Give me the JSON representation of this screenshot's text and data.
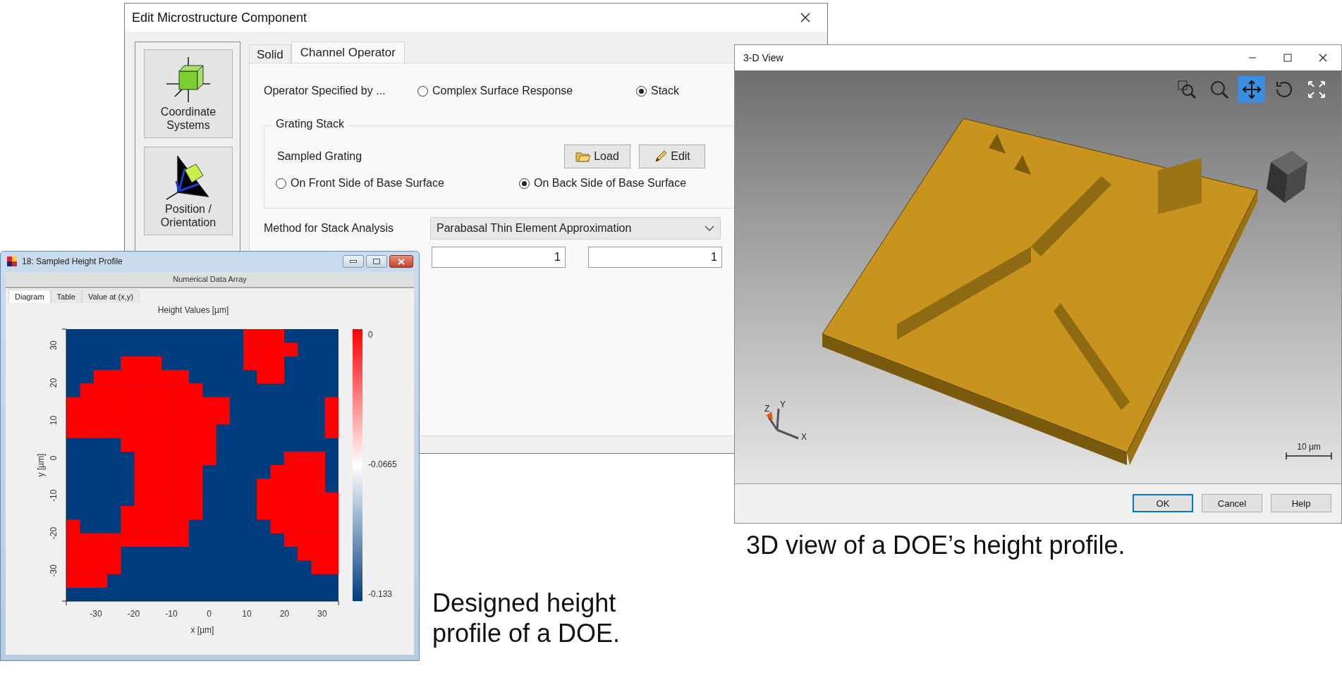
{
  "edit_dialog": {
    "title": "Edit Microstructure Component",
    "sidebar": [
      {
        "label": "Coordinate Systems",
        "kind": "axes"
      },
      {
        "label": "Position / Orientation",
        "kind": "position"
      }
    ],
    "tabs": [
      {
        "label": "Solid",
        "selected": false
      },
      {
        "label": "Channel Operator",
        "selected": true
      }
    ],
    "operator": {
      "label": "Operator Specified by ...",
      "options": [
        {
          "label": "Complex Surface Response",
          "selected": false
        },
        {
          "label": "Stack",
          "selected": true
        }
      ]
    },
    "grating_stack": {
      "title": "Grating Stack",
      "item": "Sampled Grating",
      "buttons": [
        {
          "label": "Load",
          "kind": "folder"
        },
        {
          "label": "Edit",
          "kind": "pencil"
        }
      ],
      "sides": [
        {
          "label": "On Front Side of Base Surface",
          "selected": false
        },
        {
          "label": "On Back Side of Base Surface",
          "selected": true
        }
      ]
    },
    "stack_method": {
      "label": "Method for Stack Analysis",
      "value": "Parabasal Thin Element Approximation"
    },
    "fields": [
      "1",
      "1"
    ]
  },
  "height_window": {
    "title": "18: Sampled Height Profile",
    "subtitle": "Numerical Data Array",
    "tabs": [
      {
        "label": "Diagram",
        "selected": true
      },
      {
        "label": "Table",
        "selected": false
      },
      {
        "label": "Value at (x,y)",
        "selected": false
      }
    ],
    "heatmap": {
      "title": "Height Values  [µm]",
      "xlabel": "x [µm]",
      "ylabel": "y [µm]",
      "xticks": [
        "-30",
        "-20",
        "-10",
        "0",
        "10",
        "20",
        "30"
      ],
      "yticks": [
        "30",
        "20",
        "10",
        "0",
        "-10",
        "-20",
        "-30"
      ],
      "colorbar_labels": [
        "0",
        "-0.0665",
        "-0.133"
      ]
    }
  },
  "view3d_window": {
    "title": "3-D View",
    "tools": [
      {
        "kind": "zoom-region",
        "selected": false
      },
      {
        "kind": "zoom",
        "selected": false
      },
      {
        "kind": "pan",
        "selected": true
      },
      {
        "kind": "rotate",
        "selected": false
      },
      {
        "kind": "fit",
        "selected": false
      }
    ],
    "axis_labels": [
      "Z",
      "Y",
      "X"
    ],
    "scale_label": "10 µm",
    "buttons": [
      {
        "label": "OK",
        "default": true
      },
      {
        "label": "Cancel",
        "default": false
      },
      {
        "label": "Help",
        "default": false
      }
    ]
  },
  "view3d_caption": "3D view of a DOE’s height profile.",
  "profile_caption": "Designed height profile of a DOE."
}
